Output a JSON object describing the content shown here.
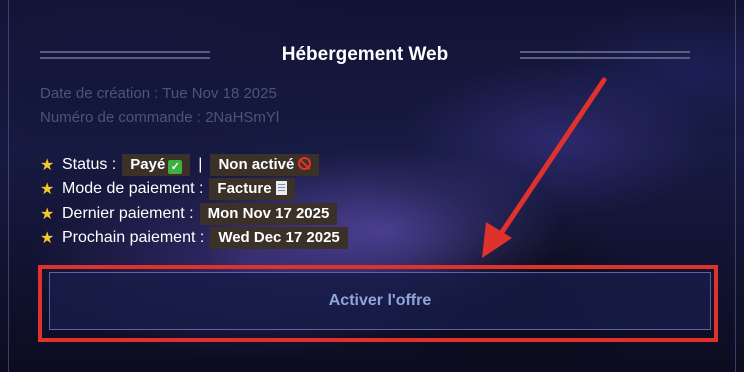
{
  "card": {
    "title": "Hébergement Web",
    "created": "Date de création : Tue Nov 18 2025",
    "order": "Numéro de commande : 2NaHSmYl"
  },
  "info": {
    "status_label": "Status :",
    "status_paid": "Payé",
    "separator": "|",
    "status_active": "Non activé",
    "payment_method_label": "Mode de paiement :",
    "payment_method": "Facture",
    "last_payment_label": "Dernier paiement :",
    "last_payment": "Mon Nov 17 2025",
    "next_payment_label": "Prochain paiement :",
    "next_payment": "Wed Dec 17 2025",
    "star": "★"
  },
  "action": {
    "activate_label": "Activer l'offre"
  },
  "icons": {
    "star": "star-icon",
    "check": "check-mark-icon",
    "prohibited": "prohibited-icon",
    "receipt": "receipt-icon"
  },
  "colors": {
    "highlight_red": "#e0322c",
    "tag_bg": "#3b3129",
    "star": "#f7c62a",
    "button_text": "#8ea6d8"
  }
}
